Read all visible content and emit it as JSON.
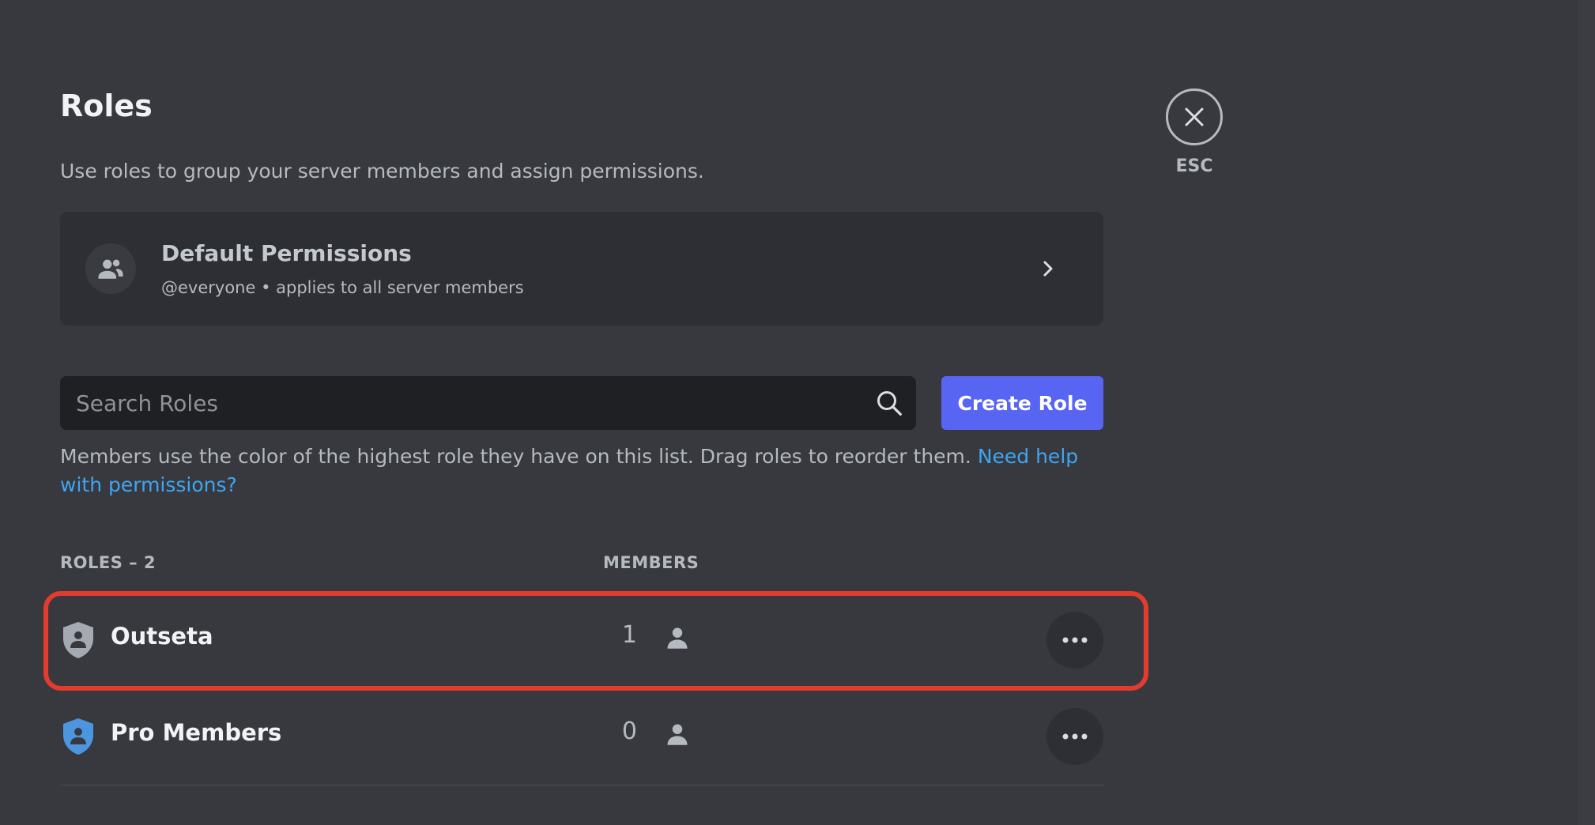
{
  "page": {
    "title": "Roles",
    "description": "Use roles to group your server members and assign permissions."
  },
  "default_permissions": {
    "title": "Default Permissions",
    "subtitle": "@everyone • applies to all server members",
    "icon": "users-icon"
  },
  "search": {
    "placeholder": "Search Roles",
    "value": ""
  },
  "create_role_label": "Create Role",
  "help": {
    "text": "Members use the color of the highest role they have on this list. Drag roles to reorder them. ",
    "link_text": "Need help with permissions?"
  },
  "columns": {
    "roles": "ROLES – 2",
    "members": "MEMBERS"
  },
  "roles": [
    {
      "name": "Outseta",
      "members": "1",
      "color": "#a5aab2"
    },
    {
      "name": "Pro Members",
      "members": "0",
      "color": "#4c96e0"
    }
  ],
  "close": {
    "label": "ESC"
  },
  "colors": {
    "accent": "#5865f2",
    "link": "#3ea6f2",
    "highlight": "#e33b2e"
  }
}
